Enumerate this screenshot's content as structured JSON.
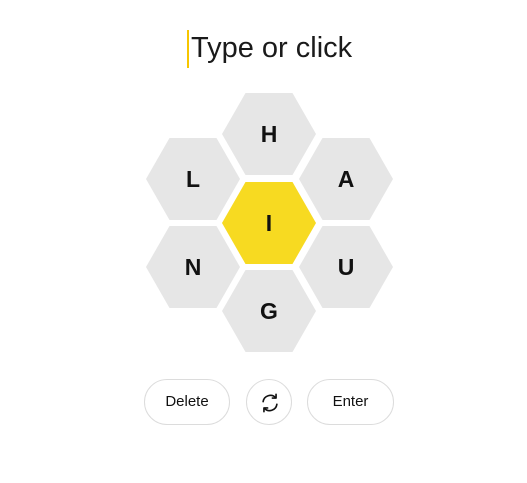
{
  "input": {
    "placeholder": "Type or click",
    "caret_color": "#f7c600"
  },
  "hive": {
    "center_letter": "I",
    "outer_letters": {
      "top": "H",
      "upper_left": "L",
      "upper_right": "A",
      "lower_left": "N",
      "lower_right": "U",
      "bottom": "G"
    },
    "center_color": "#f7da21",
    "outer_color": "#e6e6e6"
  },
  "controls": {
    "delete_label": "Delete",
    "shuffle_icon": "shuffle-icon",
    "enter_label": "Enter"
  }
}
